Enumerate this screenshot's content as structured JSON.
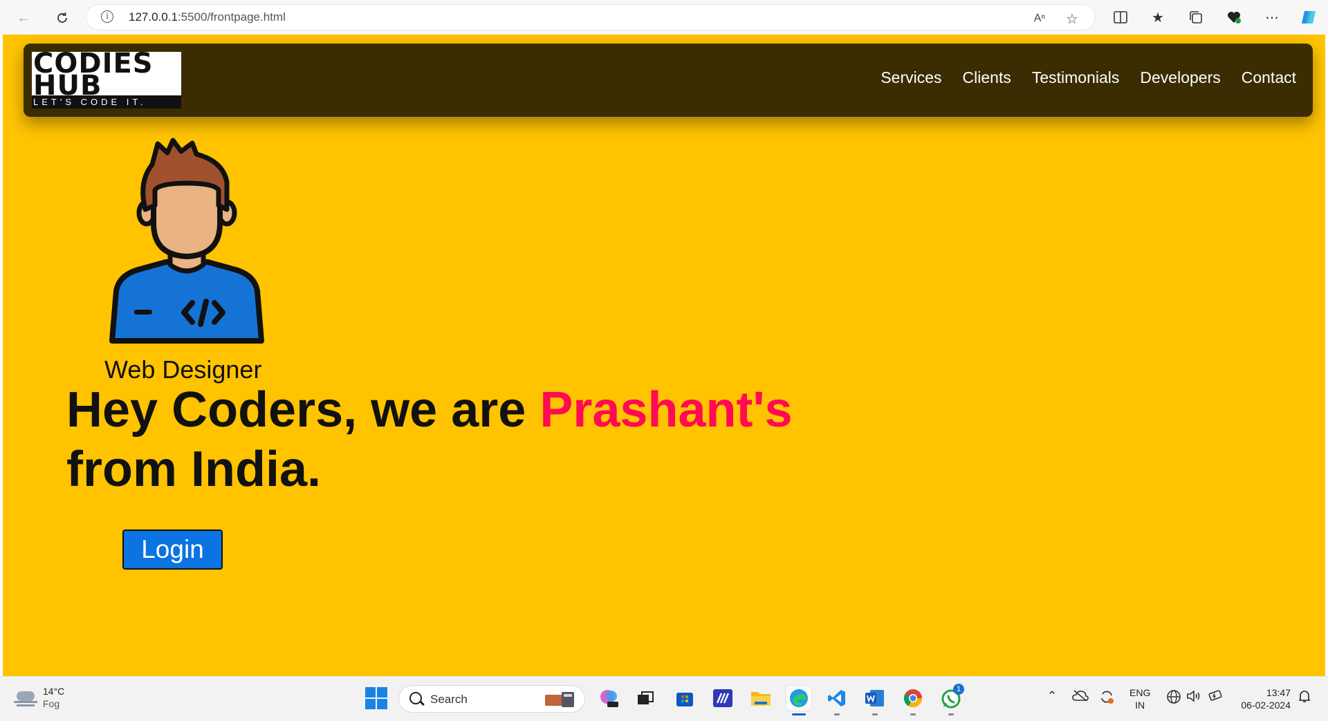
{
  "browser": {
    "url_host": "127.0.0.1",
    "url_path": ":5500/frontpage.html",
    "colors": {
      "accent": "#1883e7"
    }
  },
  "page": {
    "brand": {
      "line1": "CODIES",
      "line2": "HUB",
      "tagline": "LET'S CODE IT."
    },
    "nav": [
      "Services",
      "Clients",
      "Testimonials",
      "Developers",
      "Contact"
    ],
    "role": "Web Designer",
    "headline": {
      "before": "Hey Coders, we are ",
      "accent": "Prashant's",
      "after": "from India."
    },
    "login": "Login",
    "colors": {
      "background": "#ffc300",
      "navbar": "#3b2c02",
      "accent": "#ff0a54",
      "button": "#0c73e2"
    }
  },
  "taskbar": {
    "weather": {
      "temp": "14°C",
      "condition": "Fog"
    },
    "search_label": "Search",
    "whatsapp_badge": "1",
    "lang": {
      "line1": "ENG",
      "line2": "IN"
    },
    "clock": {
      "time": "13:47",
      "date": "06-02-2024"
    }
  }
}
